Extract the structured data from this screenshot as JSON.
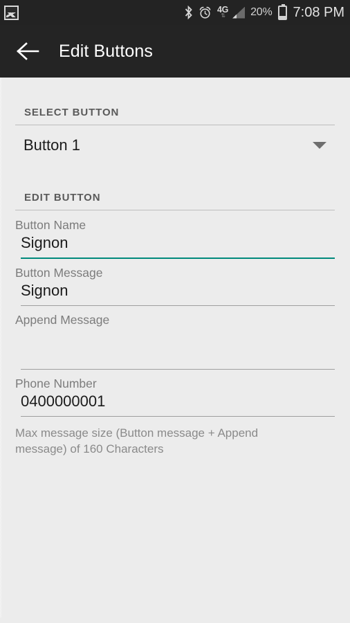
{
  "status_bar": {
    "notification_icon": "screenshot-image-icon",
    "icons": [
      "bluetooth-icon",
      "alarm-clock-icon"
    ],
    "network_label": "4G",
    "network_arrows": "⇅",
    "signal_icon": "signal-bars-icon",
    "battery_percent": "20%",
    "battery_icon": "battery-icon",
    "clock": "7:08 PM"
  },
  "app_bar": {
    "back_icon": "back-arrow-icon",
    "title": "Edit Buttons"
  },
  "sections": {
    "select_button": {
      "header": "SELECT BUTTON",
      "spinner": {
        "value": "Button 1",
        "caret_icon": "chevron-down-icon"
      }
    },
    "edit_button": {
      "header": "EDIT BUTTON",
      "fields": [
        {
          "label": "Button Name",
          "value": "Signon",
          "focused": true
        },
        {
          "label": "Button Message",
          "value": "Signon",
          "focused": false
        },
        {
          "label": "Append Message",
          "value": "",
          "focused": false
        },
        {
          "label": "Phone Number",
          "value": "0400000001",
          "focused": false
        }
      ],
      "helper_text": "Max message size (Button message + Append message) of 160 Characters"
    }
  },
  "colors": {
    "accent": "#00897B",
    "app_bar": "#242424",
    "status_bar": "#232323",
    "background": "#ECECEC",
    "label": "#7C7C7C",
    "value": "#1B1B1B"
  }
}
